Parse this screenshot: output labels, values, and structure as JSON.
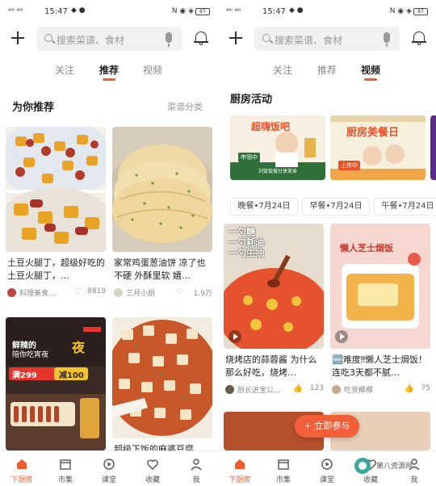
{
  "status_bar": {
    "signal": "⁴⁶ᴵ ⁴⁶ᴵ",
    "time": "15:47",
    "right_icons": "N ◉ ◈",
    "battery": "87"
  },
  "search": {
    "placeholder": "搜索菜谱、食材"
  },
  "left": {
    "tabs": [
      "关注",
      "推荐",
      "视频"
    ],
    "active_tab": "推荐",
    "section_title": "为你推荐",
    "section_link": "菜谱分类",
    "cards": [
      {
        "title": "土豆火腿丁，超级好吃的土豆火腿丁，…",
        "author": "料理美食…",
        "likes": "8819"
      },
      {
        "title": "家常鸡蛋葱油饼 凉了也不硬 外酥里软 嬉…",
        "author": "三月小厨",
        "likes": "1.9万"
      },
      {
        "title": "",
        "overlay": {
          "line1": "鲜辣的",
          "line2": "陪你吃宵夜",
          "tag1": "满299",
          "tag2": "减100"
        }
      },
      {
        "title": "超级下饭的麻婆豆腐"
      }
    ]
  },
  "right": {
    "tabs": [
      "关注",
      "推荐",
      "视频"
    ],
    "active_tab": "视频",
    "section_title": "厨房活动",
    "banners": [
      {
        "headline": "超嗨饭吧",
        "sub": "刘饭饭做分享美食",
        "badge": "申领中"
      },
      {
        "headline": "厨房美餐日",
        "badge": "上传中"
      }
    ],
    "chips": [
      "晚餐•7月24日",
      "早餐•7月24日",
      "午餐•7月24日"
    ],
    "cards": [
      {
        "title": "烧烤店的蒜蓉酱 为什么那么好吃，烧烤…",
        "author": "厨长进宝公…",
        "likes": "123",
        "overlay": [
          "一勺糖",
          "一勺耗油",
          "一勺生抽"
        ]
      },
      {
        "title": "🆕难度‼懒人芝士焗饭！连吃3天都不腻…",
        "author": "吃货椰椰",
        "likes": "75",
        "overlay": [
          "懒人芝士焗饭"
        ]
      }
    ],
    "fab_label": "+ 立即参与"
  },
  "bottom_nav": [
    {
      "label": "下厨房",
      "icon": "home-icon"
    },
    {
      "label": "市集",
      "icon": "market-icon"
    },
    {
      "label": "课堂",
      "icon": "class-icon"
    },
    {
      "label": "收藏",
      "icon": "heart-icon"
    },
    {
      "label": "我",
      "icon": "person-icon"
    }
  ],
  "watermark": "第八资源网"
}
